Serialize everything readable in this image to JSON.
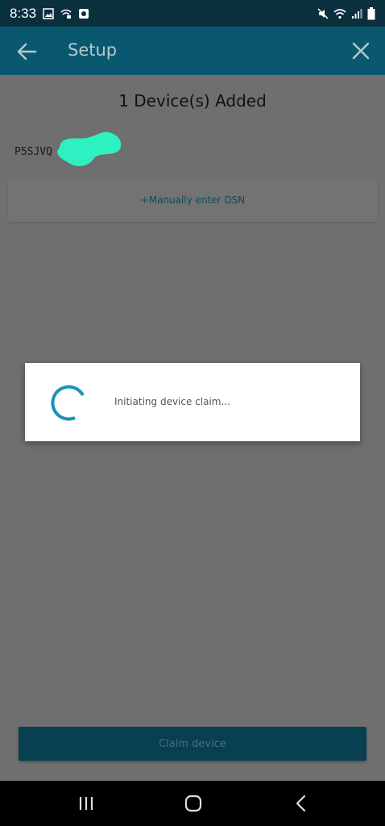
{
  "status_bar": {
    "time": "8:33",
    "icons_left": [
      "image-icon",
      "wifi-calling-icon",
      "app-icon"
    ],
    "icons_right": [
      "mute-icon",
      "wifi-icon",
      "signal-icon",
      "battery-icon"
    ]
  },
  "app_bar": {
    "title": "Setup",
    "back_icon": "arrow-left-icon",
    "close_icon": "close-icon",
    "color": "#0a5870"
  },
  "main": {
    "heading": "1 Device(s) Added",
    "device_id": "P5SJVQ",
    "manual_entry_label": "+Manually enter DSN",
    "claim_button_label": "Claim device"
  },
  "dialog": {
    "message": "Initiating device claim...",
    "spinner_color": "#1a93b8"
  },
  "colors": {
    "accent": "#1a93b8",
    "redaction": "#2ff0c0"
  }
}
